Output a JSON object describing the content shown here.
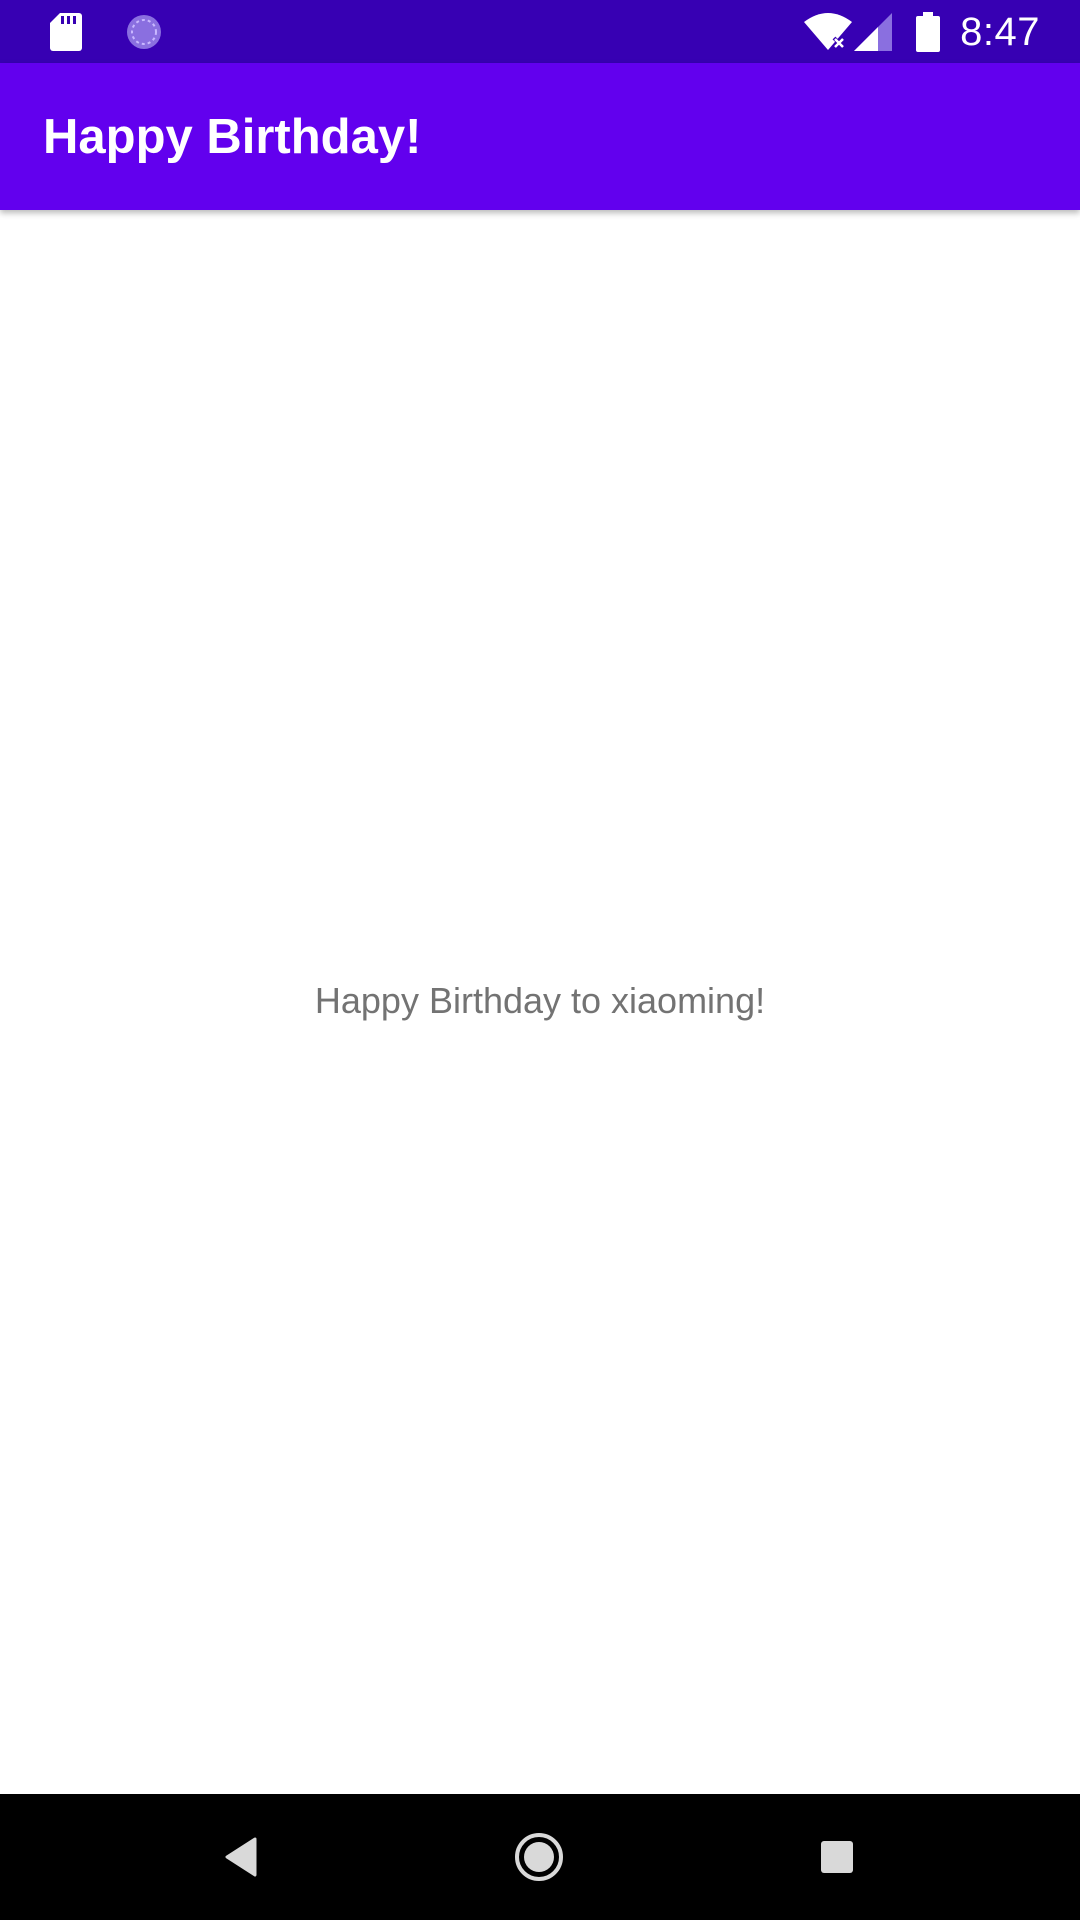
{
  "status_bar": {
    "time": "8:47",
    "icons": [
      "sd-card-icon",
      "sync-circle-icon",
      "wifi-no-internet-icon",
      "cell-signal-icon",
      "battery-icon"
    ],
    "background_color": "#3700b3"
  },
  "app_bar": {
    "title": "Happy Birthday!",
    "background_color": "#6200ee"
  },
  "main": {
    "greeting_text": "Happy Birthday to xiaoming!",
    "text_color": "#737373"
  },
  "nav_bar": {
    "buttons": [
      "back-icon",
      "home-icon",
      "recents-icon"
    ]
  }
}
